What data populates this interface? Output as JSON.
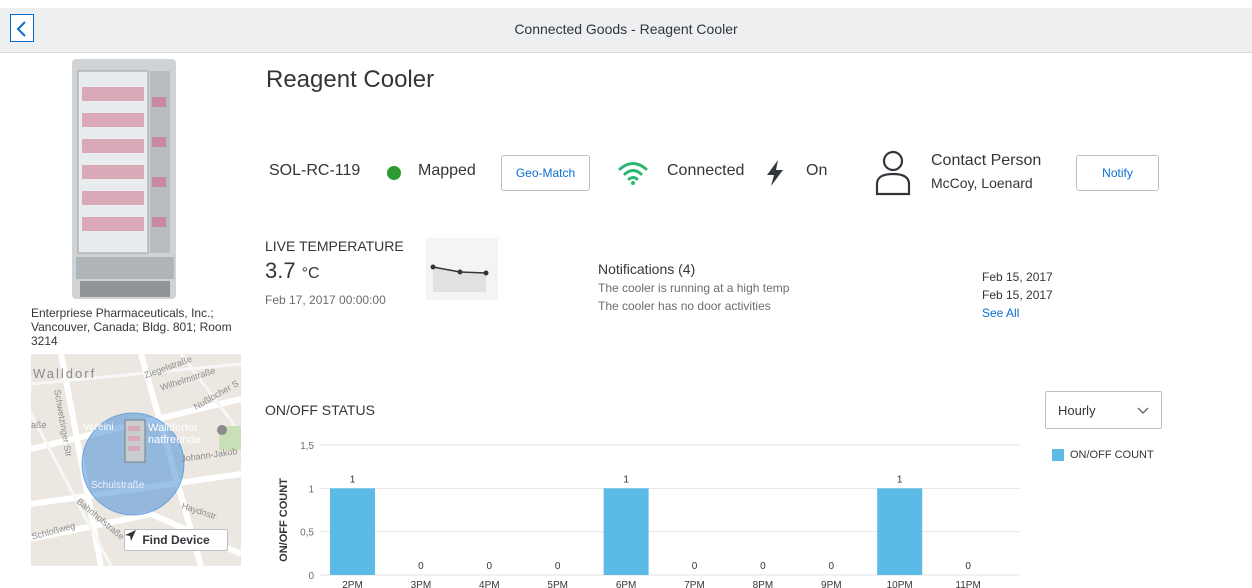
{
  "header": {
    "title": "Connected Goods - Reagent Cooler",
    "back_icon": "chevron-left-icon"
  },
  "device": {
    "name": "Reagent Cooler",
    "id": "SOL-RC-119",
    "address": "Enterpriese Pharmaceuticals, Inc.; Vancouver, Canada; Bldg. 801; Room 3214",
    "mapped_status": "Mapped",
    "mapped_color": "#2b9a2f",
    "geo_match_label": "Geo-Match",
    "connection_status": "Connected",
    "connection_color": "#2bb673",
    "power_status": "On"
  },
  "map": {
    "street_labels": [
      "Walldorf",
      "Ziegelstraße",
      "Wilhelmstraße",
      "Nußlocher S",
      "Schwetzinger Str",
      "Walldorfer",
      "natfreunde",
      "Johann-Jakob",
      "Schulstraße",
      "Haydnstr",
      "Bahnhofstraße",
      "Schloßweg",
      "Vereini",
      "aße"
    ],
    "find_device_label": "Find Device"
  },
  "contact": {
    "title": "Contact Person",
    "name": "McCoy, Loenard",
    "notify_label": "Notify"
  },
  "live_temperature": {
    "title": "LIVE TEMPERATURE",
    "value": "3.7",
    "unit": "°C",
    "timestamp": "Feb 17, 2017 00:00:00"
  },
  "notifications": {
    "title": "Notifications (4)",
    "items": [
      {
        "text": "The cooler is running at a high temp",
        "date": "Feb 15, 2017"
      },
      {
        "text": "The cooler has no door activities",
        "date": "Feb 15, 2017"
      }
    ],
    "see_all_label": "See All"
  },
  "onoff": {
    "title": "ON/OFF STATUS",
    "interval_selected": "Hourly",
    "legend_label": "ON/OFF COUNT"
  },
  "chart_data": {
    "type": "bar",
    "categories": [
      "2PM",
      "3PM",
      "4PM",
      "5PM",
      "6PM",
      "7PM",
      "8PM",
      "9PM",
      "10PM",
      "11PM"
    ],
    "series": [
      {
        "name": "ON/OFF COUNT",
        "values": [
          1,
          0,
          0,
          0,
          1,
          0,
          0,
          0,
          1,
          0
        ],
        "color": "#5cbae6"
      }
    ],
    "ylabel": "ON/OFF COUNT",
    "yticks": [
      "0",
      "0,5",
      "1",
      "1,5"
    ],
    "ylim": [
      0,
      1.5
    ],
    "grid": true,
    "legend": "top-right"
  }
}
